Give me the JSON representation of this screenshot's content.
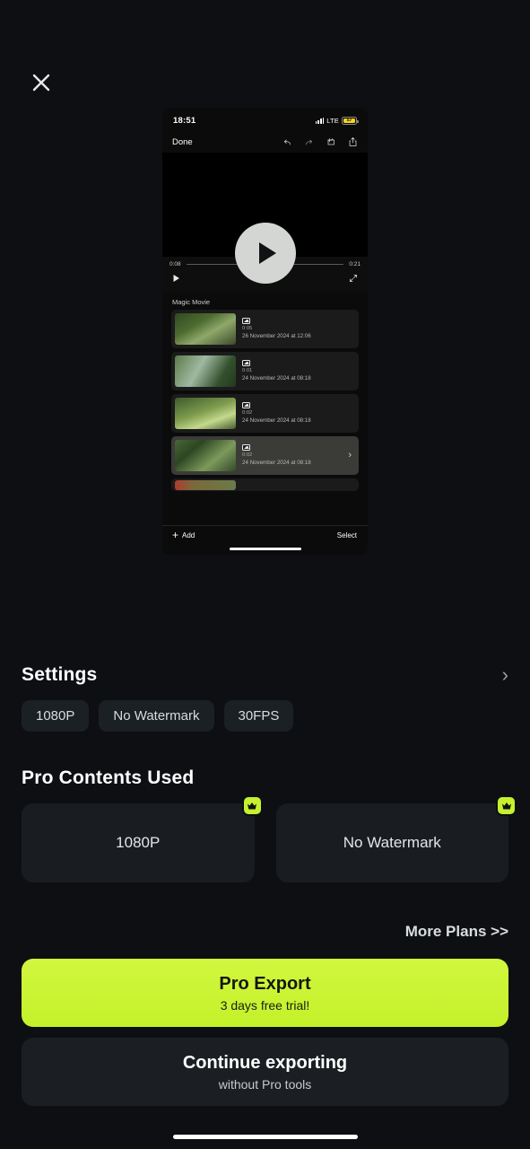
{
  "close_icon": "close-icon",
  "preview": {
    "status": {
      "time": "18:51",
      "network": "LTE",
      "battery_level": "57",
      "signal_icon": "cellular-signal-icon",
      "battery_icon": "battery-low-power-icon"
    },
    "nav": {
      "done_label": "Done",
      "icons": [
        "undo-icon",
        "redo-icon",
        "magic-adjust-icon",
        "share-icon"
      ]
    },
    "player": {
      "current_time": "0:08",
      "total_time": "0:21",
      "progress_percent": 40,
      "play_icon": "play-icon",
      "fullscreen_icon": "fullscreen-icon",
      "overlay_play_icon": "play-overlay-icon"
    },
    "list_title": "Magic Movie",
    "clips": [
      {
        "duration": "0:05",
        "date": "26 November 2024 at 12:06",
        "selected": false,
        "badge": "photo-icon"
      },
      {
        "duration": "0:01",
        "date": "24 November 2024 at 08:18",
        "selected": false,
        "badge": "photo-icon"
      },
      {
        "duration": "0:02",
        "date": "24 November 2024 at 08:18",
        "selected": false,
        "badge": "photo-icon"
      },
      {
        "duration": "0:02",
        "date": "24 November 2024 at 08:18",
        "selected": true,
        "badge": "photo-icon"
      }
    ],
    "bottom": {
      "add_label": "Add",
      "select_label": "Select",
      "plus_icon": "plus-icon"
    }
  },
  "settings": {
    "title": "Settings",
    "chevron_icon": "chevron-right-icon",
    "chips": [
      "1080P",
      "No Watermark",
      "30FPS"
    ]
  },
  "pro_contents": {
    "title": "Pro Contents Used",
    "cards": [
      {
        "label": "1080P",
        "badge_icon": "crown-icon"
      },
      {
        "label": "No Watermark",
        "badge_icon": "crown-icon"
      }
    ]
  },
  "footer": {
    "more_plans": "More Plans >>",
    "pro_export_title": "Pro Export",
    "pro_export_sub": "3 days free trial!",
    "continue_title": "Continue exporting",
    "continue_sub": "without Pro tools"
  },
  "colors": {
    "page_bg": "#0d0f13",
    "card_bg": "#191d21",
    "chip_bg": "#1b2025",
    "accent_lime": "#c5f12e",
    "cta_lime": "#c8f535",
    "text_primary": "#ffffff",
    "text_secondary": "#c6cbcf",
    "battery_yellow": "#f5d516"
  }
}
